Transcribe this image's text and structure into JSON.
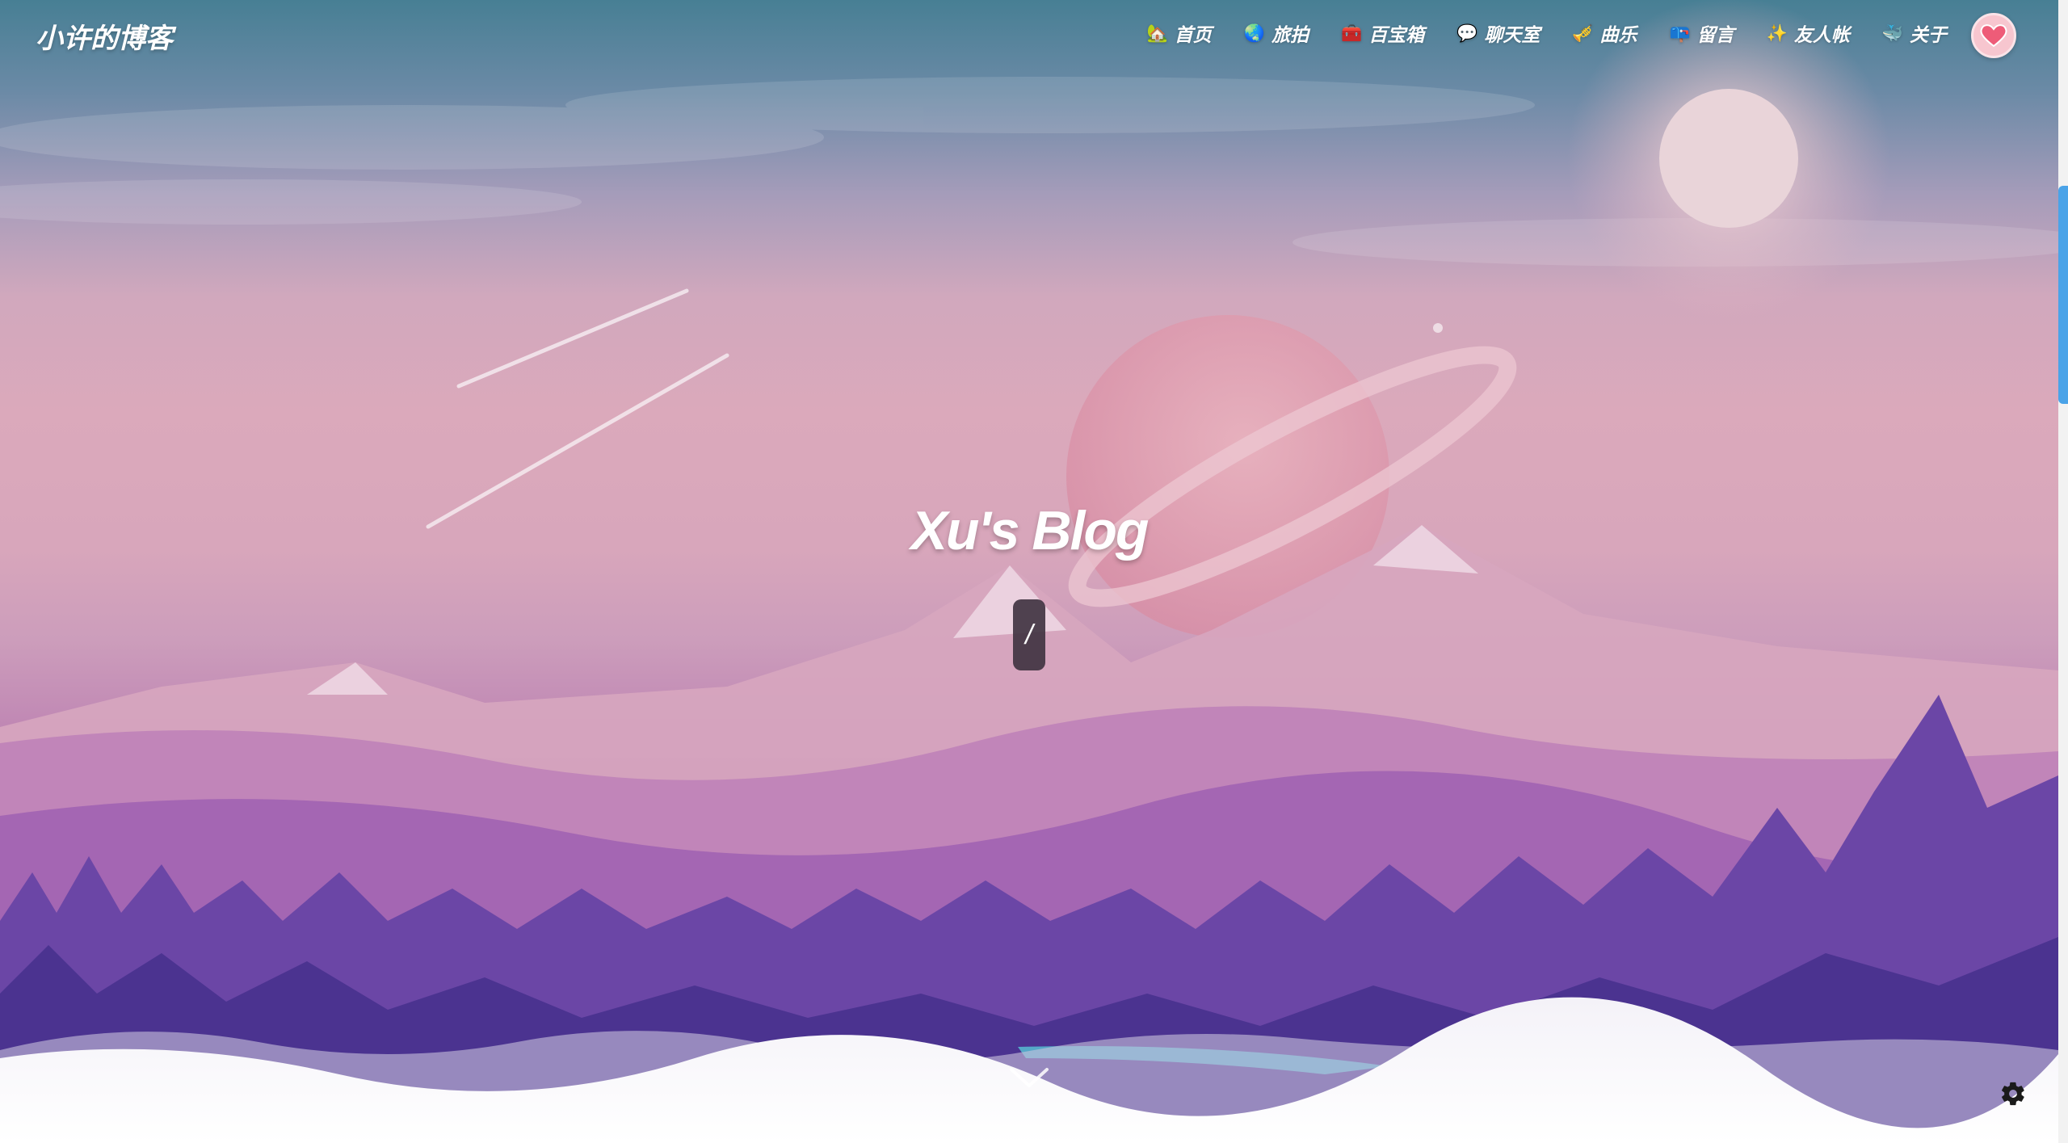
{
  "site": {
    "brand": "小许的博客"
  },
  "nav": {
    "items": [
      {
        "label": "首页",
        "icon": "🏡",
        "icon_name": "house-icon"
      },
      {
        "label": "旅拍",
        "icon": "🌏",
        "icon_name": "globe-icon"
      },
      {
        "label": "百宝箱",
        "icon": "🧰",
        "icon_name": "toolbox-icon"
      },
      {
        "label": "聊天室",
        "icon": "💬",
        "icon_name": "chat-bubble-icon"
      },
      {
        "label": "曲乐",
        "icon": "🎺",
        "icon_name": "trumpet-icon"
      },
      {
        "label": "留言",
        "icon": "📪",
        "icon_name": "mailbox-icon"
      },
      {
        "label": "友人帐",
        "icon": "✨",
        "icon_name": "sparkles-icon"
      },
      {
        "label": "关于",
        "icon": "🐳",
        "icon_name": "whale-icon"
      }
    ],
    "avatar_icon": "heart-icon"
  },
  "hero": {
    "title": "Xu's Blog",
    "typing_text": "/"
  },
  "colors": {
    "accent": "#4aa3e8",
    "text_on_hero": "#ffffff",
    "typing_box": "#413442"
  }
}
